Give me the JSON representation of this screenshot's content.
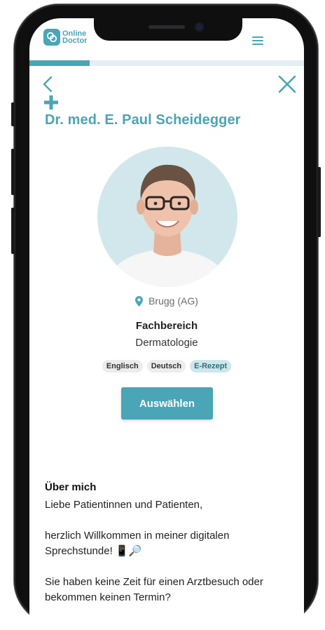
{
  "header": {
    "logo_line1": "Online",
    "logo_line2": "Doctor",
    "accent_color": "#4aa5b6",
    "progress_fraction": 0.22
  },
  "navigation": {
    "back_icon": "chevron-left-icon",
    "close_icon": "close-icon",
    "menu_icon": "hamburger-menu-icon"
  },
  "doctor": {
    "name": "Dr. med. E. Paul Scheidegger",
    "location": "Brugg (AG)",
    "specialty_label": "Fachbereich",
    "specialty_value": "Dermatologie",
    "badges": [
      {
        "label": "Englisch",
        "highlighted": false
      },
      {
        "label": "Deutsch",
        "highlighted": false
      },
      {
        "label": "E-Rezept",
        "highlighted": true
      }
    ],
    "select_label": "Auswählen"
  },
  "about": {
    "title": "Über mich",
    "paragraphs": [
      "Liebe Patientinnen und Patienten,",
      "herzlich Willkommen in meiner digitalen Sprechstunde! 📱🔎",
      "Sie haben keine Zeit für einen Arztbesuch oder bekommen keinen Termin?"
    ]
  }
}
